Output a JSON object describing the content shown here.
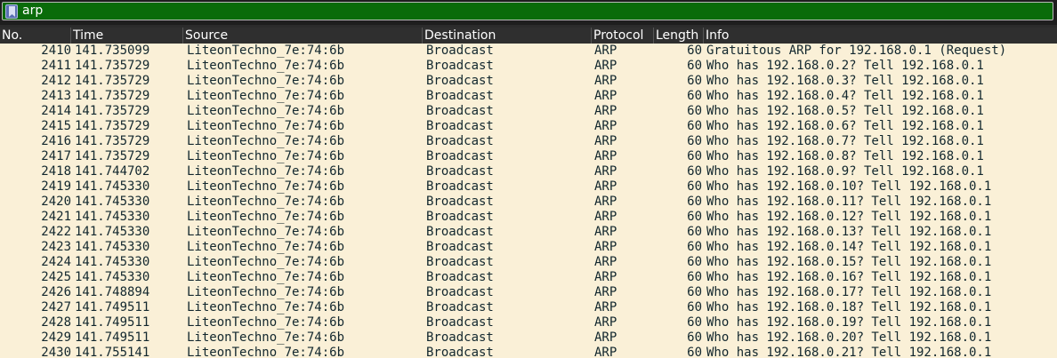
{
  "filter": {
    "value": "arp",
    "bookmark_icon": "bookmark-icon",
    "color": "#0a6b0a"
  },
  "columns": [
    "No.",
    "Time",
    "Source",
    "Destination",
    "Protocol",
    "Length",
    "Info"
  ],
  "row_color": "#faf0d7",
  "rows": [
    [
      "2410",
      "141.735099",
      "LiteonTechno_7e:74:6b",
      "Broadcast",
      "ARP",
      "60",
      "Gratuitous ARP for 192.168.0.1 (Request)"
    ],
    [
      "2411",
      "141.735729",
      "LiteonTechno_7e:74:6b",
      "Broadcast",
      "ARP",
      "60",
      "Who has 192.168.0.2? Tell 192.168.0.1"
    ],
    [
      "2412",
      "141.735729",
      "LiteonTechno_7e:74:6b",
      "Broadcast",
      "ARP",
      "60",
      "Who has 192.168.0.3? Tell 192.168.0.1"
    ],
    [
      "2413",
      "141.735729",
      "LiteonTechno_7e:74:6b",
      "Broadcast",
      "ARP",
      "60",
      "Who has 192.168.0.4? Tell 192.168.0.1"
    ],
    [
      "2414",
      "141.735729",
      "LiteonTechno_7e:74:6b",
      "Broadcast",
      "ARP",
      "60",
      "Who has 192.168.0.5? Tell 192.168.0.1"
    ],
    [
      "2415",
      "141.735729",
      "LiteonTechno_7e:74:6b",
      "Broadcast",
      "ARP",
      "60",
      "Who has 192.168.0.6? Tell 192.168.0.1"
    ],
    [
      "2416",
      "141.735729",
      "LiteonTechno_7e:74:6b",
      "Broadcast",
      "ARP",
      "60",
      "Who has 192.168.0.7? Tell 192.168.0.1"
    ],
    [
      "2417",
      "141.735729",
      "LiteonTechno_7e:74:6b",
      "Broadcast",
      "ARP",
      "60",
      "Who has 192.168.0.8? Tell 192.168.0.1"
    ],
    [
      "2418",
      "141.744702",
      "LiteonTechno_7e:74:6b",
      "Broadcast",
      "ARP",
      "60",
      "Who has 192.168.0.9? Tell 192.168.0.1"
    ],
    [
      "2419",
      "141.745330",
      "LiteonTechno_7e:74:6b",
      "Broadcast",
      "ARP",
      "60",
      "Who has 192.168.0.10? Tell 192.168.0.1"
    ],
    [
      "2420",
      "141.745330",
      "LiteonTechno_7e:74:6b",
      "Broadcast",
      "ARP",
      "60",
      "Who has 192.168.0.11? Tell 192.168.0.1"
    ],
    [
      "2421",
      "141.745330",
      "LiteonTechno_7e:74:6b",
      "Broadcast",
      "ARP",
      "60",
      "Who has 192.168.0.12? Tell 192.168.0.1"
    ],
    [
      "2422",
      "141.745330",
      "LiteonTechno_7e:74:6b",
      "Broadcast",
      "ARP",
      "60",
      "Who has 192.168.0.13? Tell 192.168.0.1"
    ],
    [
      "2423",
      "141.745330",
      "LiteonTechno_7e:74:6b",
      "Broadcast",
      "ARP",
      "60",
      "Who has 192.168.0.14? Tell 192.168.0.1"
    ],
    [
      "2424",
      "141.745330",
      "LiteonTechno_7e:74:6b",
      "Broadcast",
      "ARP",
      "60",
      "Who has 192.168.0.15? Tell 192.168.0.1"
    ],
    [
      "2425",
      "141.745330",
      "LiteonTechno_7e:74:6b",
      "Broadcast",
      "ARP",
      "60",
      "Who has 192.168.0.16? Tell 192.168.0.1"
    ],
    [
      "2426",
      "141.748894",
      "LiteonTechno_7e:74:6b",
      "Broadcast",
      "ARP",
      "60",
      "Who has 192.168.0.17? Tell 192.168.0.1"
    ],
    [
      "2427",
      "141.749511",
      "LiteonTechno_7e:74:6b",
      "Broadcast",
      "ARP",
      "60",
      "Who has 192.168.0.18? Tell 192.168.0.1"
    ],
    [
      "2428",
      "141.749511",
      "LiteonTechno_7e:74:6b",
      "Broadcast",
      "ARP",
      "60",
      "Who has 192.168.0.19? Tell 192.168.0.1"
    ],
    [
      "2429",
      "141.749511",
      "LiteonTechno_7e:74:6b",
      "Broadcast",
      "ARP",
      "60",
      "Who has 192.168.0.20? Tell 192.168.0.1"
    ],
    [
      "2430",
      "141.755141",
      "LiteonTechno_7e:74:6b",
      "Broadcast",
      "ARP",
      "60",
      "Who has 192.168.0.21? Tell 192.168.0.1"
    ]
  ]
}
